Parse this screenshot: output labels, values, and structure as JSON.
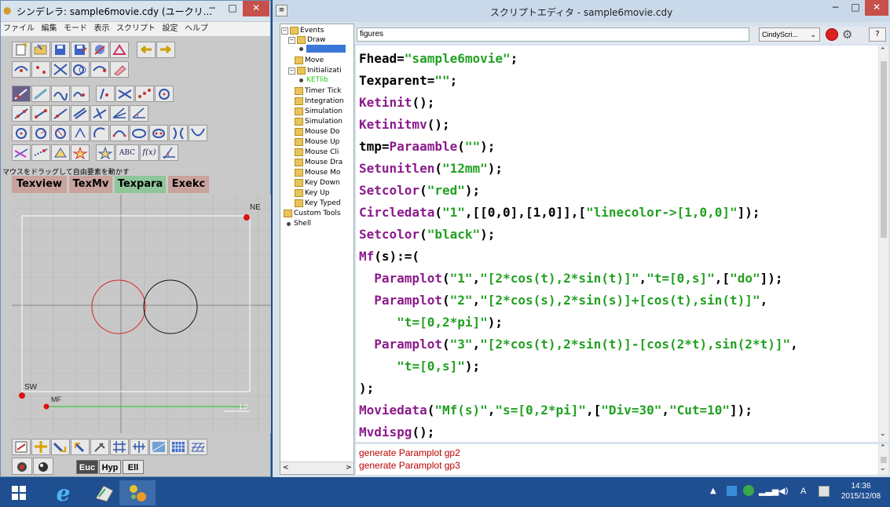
{
  "left_window": {
    "title": "シンデレラ: sample6movie.cdy (ユークリ...",
    "menu": [
      "ファイル",
      "編集",
      "モード",
      "表示",
      "スクリプト",
      "設定",
      "ヘルプ"
    ],
    "status": "マウスをドラッグして自由要素を動かす",
    "buttons": [
      {
        "label": "Texview",
        "color": "#c9a39e"
      },
      {
        "label": "TexMv",
        "color": "#c9a39e"
      },
      {
        "label": "Texpara",
        "color": "#8fc79a"
      },
      {
        "label": "Exekc",
        "color": "#c9a39e"
      }
    ],
    "canvas": {
      "point_ne": "NE",
      "point_sw": "SW",
      "point_mf": "MF",
      "slider_label": "1.0"
    },
    "tb_text": {
      "abc": "ABC",
      "fx": "f(x)"
    },
    "modes": [
      "Euc",
      "Hyp",
      "Ell"
    ]
  },
  "right_window": {
    "title": "スクリプトエディタ - sample6movie.cdy",
    "tree": [
      {
        "label": "Events",
        "kind": "folder",
        "level": 0
      },
      {
        "label": "Draw",
        "kind": "folder",
        "level": 1
      },
      {
        "label": "",
        "kind": "item",
        "level": 2
      },
      {
        "label": "Move",
        "kind": "folder",
        "level": 1
      },
      {
        "label": "Initializati",
        "kind": "folder",
        "level": 1
      },
      {
        "label": "KETlib",
        "kind": "item",
        "level": 2
      },
      {
        "label": "Timer Tick",
        "kind": "folder",
        "level": 1
      },
      {
        "label": "Integration",
        "kind": "folder",
        "level": 1
      },
      {
        "label": "Simulation",
        "kind": "folder",
        "level": 1
      },
      {
        "label": "Simulation",
        "kind": "folder",
        "level": 1
      },
      {
        "label": "Mouse Do",
        "kind": "folder",
        "level": 1
      },
      {
        "label": "Mouse Up",
        "kind": "folder",
        "level": 1
      },
      {
        "label": "Mouse Cli",
        "kind": "folder",
        "level": 1
      },
      {
        "label": "Mouse Dra",
        "kind": "folder",
        "level": 1
      },
      {
        "label": "Mouse Mo",
        "kind": "folder",
        "level": 1
      },
      {
        "label": "Key Down",
        "kind": "folder",
        "level": 1
      },
      {
        "label": "Key Up",
        "kind": "folder",
        "level": 1
      },
      {
        "label": "Key Typed",
        "kind": "folder",
        "level": 1
      },
      {
        "label": "Custom Tools",
        "kind": "folder",
        "level": 0
      },
      {
        "label": "Shell",
        "kind": "item",
        "level": 0
      }
    ],
    "figure_name": "figures",
    "language": "CindyScri...",
    "help_label": "?",
    "code_lines": [
      "Fhead=\"sample6movie\";",
      "Texparent=\"\";",
      "Ketinit();",
      "Ketinitmv();",
      "tmp=Paraamble(\"\");",
      "Setunitlen(\"12mm\");",
      "Setcolor(\"red\");",
      "Circledata(\"1\",[[0,0],[1,0]],[\"linecolor->[1,0,0]\"]);",
      "Setcolor(\"black\");",
      "Mf(s):=(",
      "  Paramplot(\"1\",\"[2*cos(t),2*sin(t)]\",\"t=[0,s]\",[\"do\"]);",
      "  Paramplot(\"2\",\"[2*cos(s),2*sin(s)]+[cos(t),sin(t)]\",",
      "     \"t=[0,2*pi]\");",
      "  Paramplot(\"3\",\"[2*cos(t),2*sin(t)]-[cos(2*t),sin(2*t)]\",",
      "     \"t=[0,s]\");",
      ");",
      "Moviedata(\"Mf(s)\",\"s=[0,2*pi]\",[\"Div=30\",\"Cut=10\"]);",
      "Mvdispg();"
    ],
    "console": [
      "generate Paramplot gp2",
      "generate Paramplot gp3"
    ]
  },
  "taskbar": {
    "clock_time": "14:36",
    "clock_date": "2015/12/08",
    "ime_label": "A"
  }
}
